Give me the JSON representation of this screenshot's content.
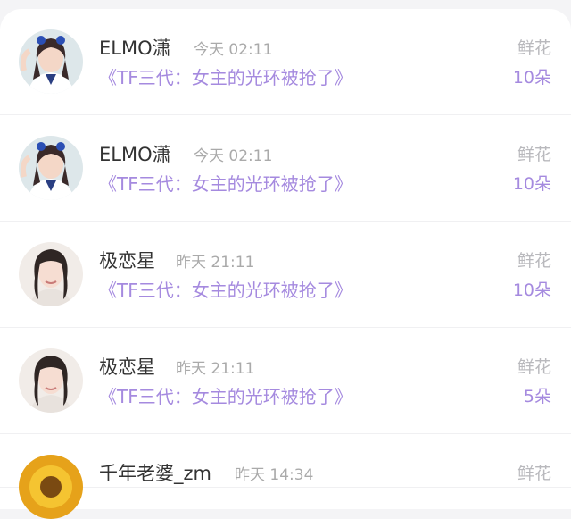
{
  "gifts": [
    {
      "avatar_icon": "girl-school-uniform-avatar",
      "user": "ELMO潇",
      "time": "今天 02:11",
      "title": "《TF三代：女主的光环被抢了》",
      "gift": "鲜花",
      "count": "10朵"
    },
    {
      "avatar_icon": "girl-school-uniform-avatar",
      "user": "ELMO潇",
      "time": "今天 02:11",
      "title": "《TF三代：女主的光环被抢了》",
      "gift": "鲜花",
      "count": "10朵"
    },
    {
      "avatar_icon": "girl-portrait-avatar",
      "user": "极恋星",
      "time": "昨天 21:11",
      "title": "《TF三代：女主的光环被抢了》",
      "gift": "鲜花",
      "count": "10朵"
    },
    {
      "avatar_icon": "girl-portrait-avatar",
      "user": "极恋星",
      "time": "昨天 21:11",
      "title": "《TF三代：女主的光环被抢了》",
      "gift": "鲜花",
      "count": "5朵"
    },
    {
      "avatar_icon": "sunflower-avatar",
      "user": "千年老婆_zm",
      "time": "昨天 14:34",
      "title": "",
      "gift": "鲜花",
      "count": ""
    }
  ],
  "colors": {
    "accent": "#a58adf",
    "muted": "#aaaaaa",
    "name": "#333333"
  }
}
